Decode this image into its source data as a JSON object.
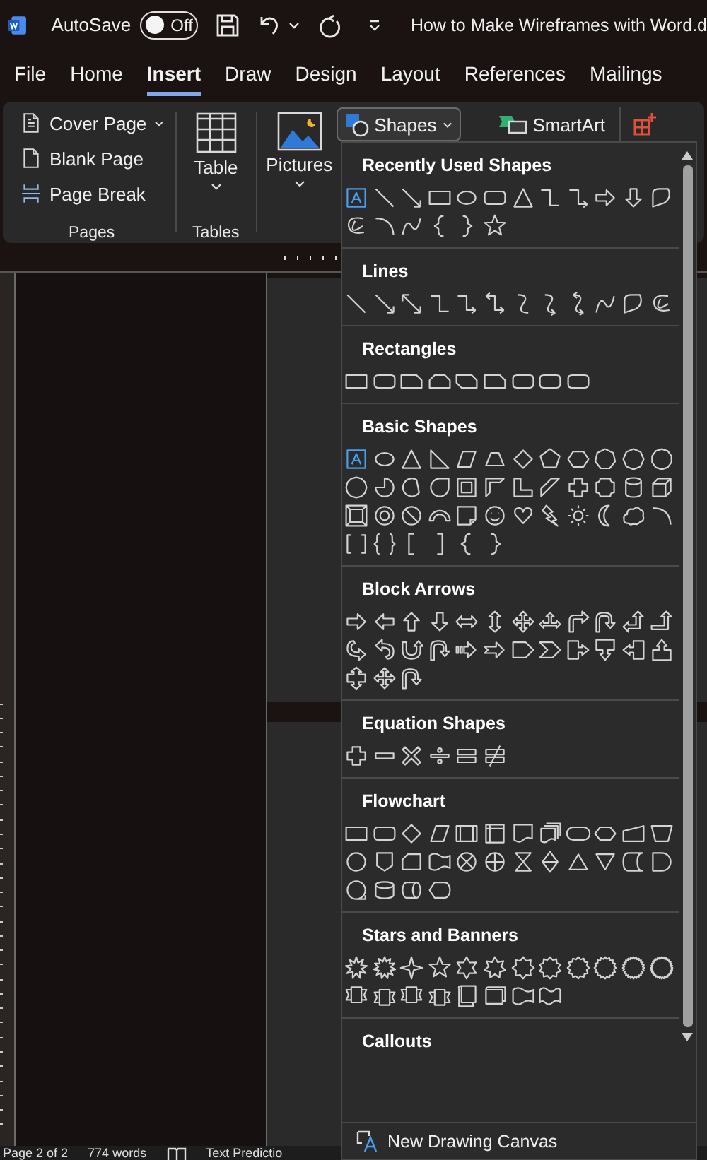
{
  "title_bar": {
    "autosave_label": "AutoSave",
    "autosave": {
      "on": false,
      "label": "Off"
    },
    "document_title": "How to Make Wireframes with Word.d"
  },
  "tabs": [
    {
      "label": "File",
      "selected": false
    },
    {
      "label": "Home",
      "selected": false
    },
    {
      "label": "Insert",
      "selected": true
    },
    {
      "label": "Draw",
      "selected": false
    },
    {
      "label": "Design",
      "selected": false
    },
    {
      "label": "Layout",
      "selected": false
    },
    {
      "label": "References",
      "selected": false
    },
    {
      "label": "Mailings",
      "selected": false
    }
  ],
  "ribbon": {
    "pages": {
      "label": "Pages",
      "items": [
        {
          "kind": "cover",
          "label": "Cover Page"
        },
        {
          "kind": "blank",
          "label": "Blank Page"
        },
        {
          "kind": "break",
          "label": "Page Break"
        }
      ]
    },
    "tables": {
      "label": "Tables",
      "button": "Table"
    },
    "pictures": {
      "button": "Pictures"
    },
    "shapes": {
      "label": "Shapes",
      "expanded": true
    },
    "smartart": {
      "label": "SmartArt"
    }
  },
  "shapes_gallery": {
    "sections": [
      {
        "title": "Recently Used Shapes",
        "shapes": [
          {
            "kind": "textbox"
          },
          {
            "kind": "line"
          },
          {
            "kind": "arrow"
          },
          {
            "kind": "rect"
          },
          {
            "kind": "ellipse"
          },
          {
            "kind": "roundrect"
          },
          {
            "kind": "triangle"
          },
          {
            "kind": "elbow"
          },
          {
            "kind": "elbowa"
          },
          {
            "kind": "arrowright"
          },
          {
            "kind": "arrowdown"
          },
          {
            "kind": "freeform"
          },
          {
            "kind": "scribble"
          },
          {
            "kind": "arc"
          },
          {
            "kind": "curve"
          },
          {
            "kind": "bracel"
          },
          {
            "kind": "bracer"
          },
          {
            "kind": "star5"
          }
        ]
      },
      {
        "title": "Lines",
        "shapes": [
          {
            "kind": "line"
          },
          {
            "kind": "arrow"
          },
          {
            "kind": "darrow"
          },
          {
            "kind": "elbow"
          },
          {
            "kind": "elbowa"
          },
          {
            "kind": "elbowda"
          },
          {
            "kind": "scurve"
          },
          {
            "kind": "scurvea"
          },
          {
            "kind": "scurveda"
          },
          {
            "kind": "curve"
          },
          {
            "kind": "freeform"
          },
          {
            "kind": "scribble"
          }
        ]
      },
      {
        "title": "Rectangles",
        "shapes": [
          {
            "kind": "rect"
          },
          {
            "kind": "roundrect"
          },
          {
            "kind": "snip1"
          },
          {
            "kind": "snip2"
          },
          {
            "kind": "snipdiag"
          },
          {
            "kind": "snip1"
          },
          {
            "kind": "roundrect"
          },
          {
            "kind": "roundrect"
          },
          {
            "kind": "roundrect"
          }
        ]
      },
      {
        "title": "Basic Shapes",
        "shapes": [
          {
            "kind": "textbox"
          },
          {
            "kind": "ellipse"
          },
          {
            "kind": "triangle"
          },
          {
            "kind": "rtri"
          },
          {
            "kind": "parallelogram"
          },
          {
            "kind": "trapezoid"
          },
          {
            "kind": "diamond"
          },
          {
            "kind": "pentagon"
          },
          {
            "kind": "hexagon"
          },
          {
            "kind": "poly7"
          },
          {
            "kind": "poly8"
          },
          {
            "kind": "poly10"
          },
          {
            "kind": "poly12"
          },
          {
            "kind": "pie"
          },
          {
            "kind": "chord"
          },
          {
            "kind": "teardrop"
          },
          {
            "kind": "frame"
          },
          {
            "kind": "halfframe"
          },
          {
            "kind": "lshape"
          },
          {
            "kind": "diagstripe"
          },
          {
            "kind": "cross"
          },
          {
            "kind": "plaque"
          },
          {
            "kind": "cylinder"
          },
          {
            "kind": "cube"
          },
          {
            "kind": "bevel"
          },
          {
            "kind": "donut"
          },
          {
            "kind": "nosym"
          },
          {
            "kind": "blockarc"
          },
          {
            "kind": "folded"
          },
          {
            "kind": "smiley"
          },
          {
            "kind": "heart"
          },
          {
            "kind": "lightning"
          },
          {
            "kind": "sun"
          },
          {
            "kind": "moon"
          },
          {
            "kind": "cloud"
          },
          {
            "kind": "arc"
          },
          {
            "kind": "bracketpair"
          },
          {
            "kind": "bracepair"
          },
          {
            "kind": "bracketl"
          },
          {
            "kind": "bracketr"
          },
          {
            "kind": "bracel"
          },
          {
            "kind": "bracer"
          }
        ]
      },
      {
        "title": "Block Arrows",
        "shapes": [
          {
            "kind": "arrowright"
          },
          {
            "kind": "arrowleft"
          },
          {
            "kind": "arrowup"
          },
          {
            "kind": "arrowdown"
          },
          {
            "kind": "arrowlr"
          },
          {
            "kind": "arrowud"
          },
          {
            "kind": "arrowquad"
          },
          {
            "kind": "arrowlru"
          },
          {
            "kind": "bentarrow"
          },
          {
            "kind": "uturn"
          },
          {
            "kind": "leftup"
          },
          {
            "kind": "bentup"
          },
          {
            "kind": "curvedright"
          },
          {
            "kind": "curvedleft"
          },
          {
            "kind": "curvedup"
          },
          {
            "kind": "curveddown"
          },
          {
            "kind": "striped"
          },
          {
            "kind": "notched"
          },
          {
            "kind": "homeplate"
          },
          {
            "kind": "chevron"
          },
          {
            "kind": "calloutright"
          },
          {
            "kind": "calloutdown"
          },
          {
            "kind": "calloutleft"
          },
          {
            "kind": "calloutup"
          },
          {
            "kind": "calloutud"
          },
          {
            "kind": "calloutquad"
          },
          {
            "kind": "uturn"
          }
        ]
      },
      {
        "title": "Equation Shapes",
        "shapes": [
          {
            "kind": "plus"
          },
          {
            "kind": "minus"
          },
          {
            "kind": "multiply"
          },
          {
            "kind": "divide"
          },
          {
            "kind": "equal"
          },
          {
            "kind": "notequal"
          }
        ]
      },
      {
        "title": "Flowchart",
        "shapes": [
          {
            "kind": "rect"
          },
          {
            "kind": "roundrect"
          },
          {
            "kind": "diamond"
          },
          {
            "kind": "parallelogram"
          },
          {
            "kind": "predefined"
          },
          {
            "kind": "internal"
          },
          {
            "kind": "document"
          },
          {
            "kind": "multidoc"
          },
          {
            "kind": "terminator"
          },
          {
            "kind": "preparation"
          },
          {
            "kind": "manualinput"
          },
          {
            "kind": "manualop"
          },
          {
            "kind": "circle"
          },
          {
            "kind": "offpage"
          },
          {
            "kind": "card"
          },
          {
            "kind": "punched"
          },
          {
            "kind": "summing"
          },
          {
            "kind": "or"
          },
          {
            "kind": "collate"
          },
          {
            "kind": "sort"
          },
          {
            "kind": "extract"
          },
          {
            "kind": "merge"
          },
          {
            "kind": "storeddata"
          },
          {
            "kind": "delay"
          },
          {
            "kind": "seqaccess"
          },
          {
            "kind": "disk"
          },
          {
            "kind": "directaccess"
          },
          {
            "kind": "display"
          }
        ]
      },
      {
        "title": "Stars and Banners",
        "shapes": [
          {
            "kind": "burst1"
          },
          {
            "kind": "burst2"
          },
          {
            "kind": "star4"
          },
          {
            "kind": "star5"
          },
          {
            "kind": "star6"
          },
          {
            "kind": "star7"
          },
          {
            "kind": "star8"
          },
          {
            "kind": "star10"
          },
          {
            "kind": "star12"
          },
          {
            "kind": "star16"
          },
          {
            "kind": "star24"
          },
          {
            "kind": "star32"
          },
          {
            "kind": "ribbondown"
          },
          {
            "kind": "ribbonup"
          },
          {
            "kind": "ribbondown"
          },
          {
            "kind": "ribbonup"
          },
          {
            "kind": "scrollv"
          },
          {
            "kind": "scrollh"
          },
          {
            "kind": "wave"
          },
          {
            "kind": "doublewave"
          }
        ]
      },
      {
        "title": "Callouts"
      }
    ],
    "footer": "New Drawing Canvas"
  },
  "status_bar": {
    "page": "Page 2 of 2",
    "words": "774 words",
    "prediction": "Text Predictio"
  }
}
